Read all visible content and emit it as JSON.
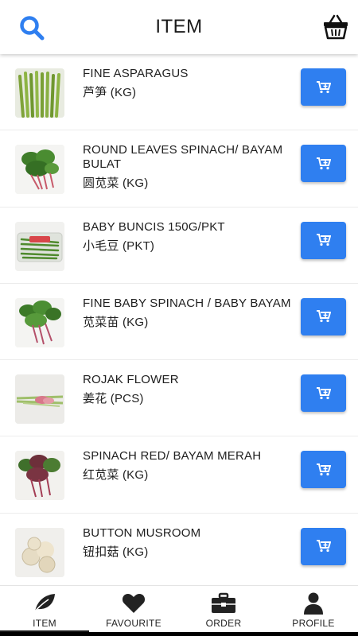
{
  "header": {
    "title": "ITEM",
    "search_icon": "search-icon",
    "basket_icon": "basket-icon",
    "accent_color": "#2f7ff0"
  },
  "items": [
    {
      "name": "FINE ASPARAGUS",
      "sub": "芦笋 (KG)",
      "image": "asparagus"
    },
    {
      "name": "ROUND LEAVES SPINACH/ BAYAM BULAT",
      "sub": "圆苋菜 (KG)",
      "image": "spinach"
    },
    {
      "name": "BABY BUNCIS 150G/PKT",
      "sub": "小毛豆 (PKT)",
      "image": "beans-pack"
    },
    {
      "name": "FINE BABY SPINACH / BABY BAYAM",
      "sub": "苋菜苗 (KG)",
      "image": "baby-spinach"
    },
    {
      "name": "ROJAK FLOWER",
      "sub": "姜花 (PCS)",
      "image": "ginger-flower"
    },
    {
      "name": "SPINACH RED/ BAYAM MERAH",
      "sub": "红苋菜 (KG)",
      "image": "red-spinach"
    },
    {
      "name": "BUTTON MUSROOM",
      "sub": "钮扣菇 (KG)",
      "image": "mushroom"
    }
  ],
  "cart_button_icon": "add-to-cart-icon",
  "nav": [
    {
      "label": "ITEM",
      "icon": "leaf-icon",
      "active": true
    },
    {
      "label": "FAVOURITE",
      "icon": "heart-icon",
      "active": false
    },
    {
      "label": "ORDER",
      "icon": "briefcase-icon",
      "active": false
    },
    {
      "label": "PROFILE",
      "icon": "person-icon",
      "active": false
    }
  ]
}
